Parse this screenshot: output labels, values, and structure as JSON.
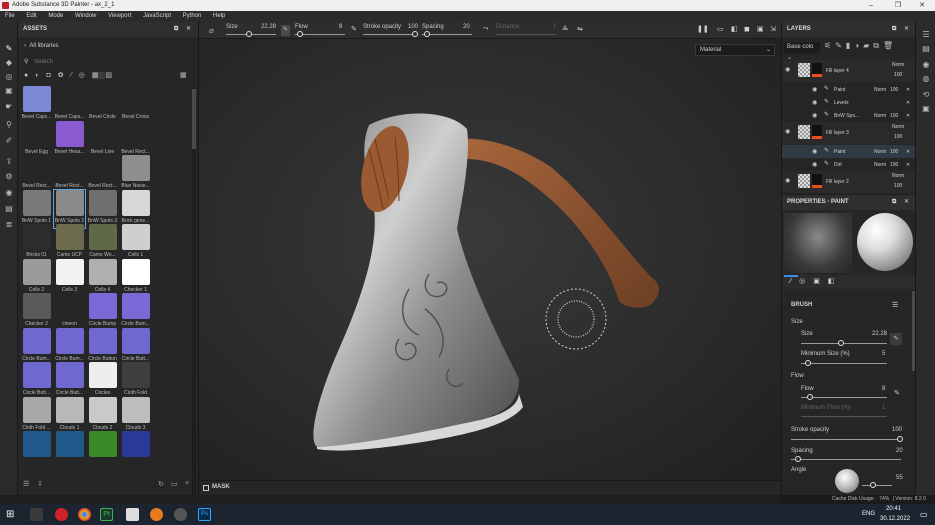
{
  "window": {
    "title": "Adobe Substance 3D Painter - ax_2_1",
    "minimize": "–",
    "maximize": "❐",
    "close": "✕"
  },
  "menu": [
    "File",
    "Edit",
    "Mode",
    "Window",
    "Viewport",
    "JavaScript",
    "Python",
    "Help"
  ],
  "assets": {
    "title": "ASSETS",
    "library": "All libraries",
    "search_placeholder": "Search",
    "items": [
      {
        "label": "Bevel Caps...",
        "color": "#7d88d6"
      },
      {
        "label": "Bevel Caps...",
        "color": "#262626"
      },
      {
        "label": "Bevel Circle",
        "color": "#262626"
      },
      {
        "label": "Bevel Cross",
        "color": "#262626"
      },
      {
        "label": "Bevel Egg",
        "color": "#262626"
      },
      {
        "label": "Bevel Hexa...",
        "color": "#8a5ad0"
      },
      {
        "label": "Bevel Line",
        "color": "#262626"
      },
      {
        "label": "Bevel Rect...",
        "color": "#262626"
      },
      {
        "label": "Bevel Rect...",
        "color": "#262626"
      },
      {
        "label": "Bevel Rect...",
        "color": "#262626"
      },
      {
        "label": "Bevel Rect...",
        "color": "#262626"
      },
      {
        "label": "Blue Noise...",
        "color": "#8e8e8e"
      },
      {
        "label": "BnW Spots 1",
        "color": "#7a7a7a"
      },
      {
        "label": "BnW Spots 2",
        "color": "#8a8a8a"
      },
      {
        "label": "BnW Spots 3",
        "color": "#6f6f6f"
      },
      {
        "label": "Brick gene...",
        "color": "#d8d8d8"
      },
      {
        "label": "Bricks 01",
        "color": "#2c2c2c"
      },
      {
        "label": "Camo UCP",
        "color": "#6d6b4e"
      },
      {
        "label": "Camo Wo...",
        "color": "#5d6a45"
      },
      {
        "label": "Cells 1",
        "color": "#cfcfcf"
      },
      {
        "label": "Cells 2",
        "color": "#9a9a9a"
      },
      {
        "label": "Cells 3",
        "color": "#f2f2f2"
      },
      {
        "label": "Cells 4",
        "color": "#b0b0b0"
      },
      {
        "label": "Checker 1",
        "color": "#ffffff"
      },
      {
        "label": "Checker 2",
        "color": "#5a5a5a"
      },
      {
        "label": "cineon",
        "color": "#262626"
      },
      {
        "label": "Circle Bump",
        "color": "#7a6ad8"
      },
      {
        "label": "Circle Bum...",
        "color": "#7a6ad8"
      },
      {
        "label": "Circle Bum...",
        "color": "#6f68d0"
      },
      {
        "label": "Circle Bum...",
        "color": "#6f68d0"
      },
      {
        "label": "Circle Button",
        "color": "#6f68d0"
      },
      {
        "label": "Circle Butt...",
        "color": "#6f68d0"
      },
      {
        "label": "Circle Butt...",
        "color": "#6f68d0"
      },
      {
        "label": "Circle Butt...",
        "color": "#6f68d0"
      },
      {
        "label": "Circles",
        "color": "#eeeeee"
      },
      {
        "label": "Cloth Fold",
        "color": "#3e3e3e"
      },
      {
        "label": "Cloth Fold ...",
        "color": "#a8a8a8"
      },
      {
        "label": "Clouds 1",
        "color": "#b8b8b8"
      },
      {
        "label": "Clouds 2",
        "color": "#c9c9c9"
      },
      {
        "label": "Clouds 3",
        "color": "#bdbdbd"
      },
      {
        "label": "",
        "color": "#1f5a8a"
      },
      {
        "label": "",
        "color": "#1f5a8a"
      },
      {
        "label": "",
        "color": "#3a8a2a"
      },
      {
        "label": "",
        "color": "#2a3a9a"
      }
    ]
  },
  "topbar": {
    "size_label": "Size",
    "size_value": "22.28",
    "flow_label": "Flow",
    "flow_value": "8",
    "stroke_label": "Stroke opacity",
    "stroke_value": "100",
    "spacing_label": "Spacing",
    "spacing_value": "20",
    "distance_label": "Distance",
    "distance_value": "1",
    "material_select": "Material"
  },
  "viewport": {
    "mask_label": "MASK"
  },
  "layers": {
    "title": "LAYERS",
    "channel": "Base colo",
    "rows": [
      {
        "name": "Fill layer 4",
        "blend": "Norm",
        "opacity": "100",
        "opacity2": "100",
        "sub": false
      },
      {
        "name": "Paint",
        "blend": "Norm",
        "opacity": "100",
        "sub": true
      },
      {
        "name": "Levels",
        "blend": "",
        "opacity": "",
        "sub": true
      },
      {
        "name": "BnW Spo...",
        "blend": "Norm",
        "opacity": "100",
        "sub": true
      },
      {
        "name": "Fill layer 3",
        "blend": "Norm",
        "opacity": "100",
        "opacity2": "100",
        "sub": false
      },
      {
        "name": "Paint",
        "blend": "Norm",
        "opacity": "100",
        "sub": true
      },
      {
        "name": "Dirt",
        "blend": "Norm",
        "opacity": "100",
        "sub": true
      },
      {
        "name": "Fill layer 2",
        "blend": "Norm",
        "opacity": "100",
        "opacity2": "100",
        "sub": false
      }
    ]
  },
  "properties": {
    "title": "PROPERTIES - PAINT",
    "section": "BRUSH",
    "size_group": "Size",
    "size_label": "Size",
    "size_value": "22.28",
    "minsize_label": "Minimum Size (%)",
    "minsize_value": "5",
    "flow_group": "Flow",
    "flow_label": "Flow",
    "flow_value": "8",
    "minflow_label": "Minimum Flow (%)",
    "minflow_value": "1",
    "stroke_label": "Stroke opacity",
    "stroke_value": "100",
    "spacing_label": "Spacing",
    "spacing_value": "20",
    "angle_label": "Angle",
    "angle_value": "55"
  },
  "status": {
    "disk": "Cache Disk Usage:",
    "disk_value": "74%",
    "version": "| Version: 8.2.0"
  },
  "taskbar": {
    "lang": "ENG",
    "time": "20:41",
    "date": "30.12.2022"
  }
}
